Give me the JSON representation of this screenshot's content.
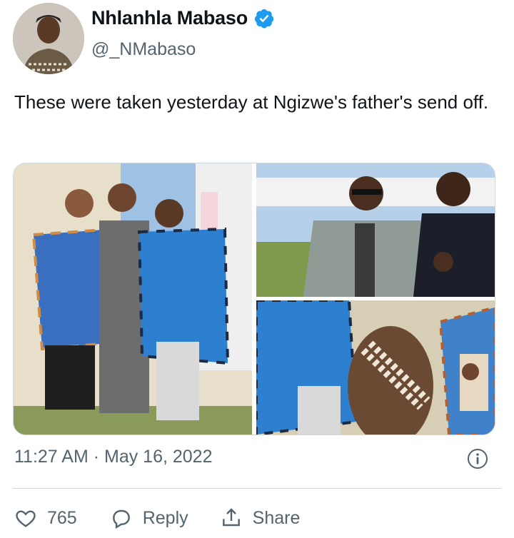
{
  "author": {
    "display_name": "Nhlanhla Mabaso",
    "handle": "@_NMabaso",
    "verified": true,
    "avatar_icon": "profile-avatar"
  },
  "tweet": {
    "text": "These were taken yesterday at Ngizwe's father's send off.",
    "timestamp": "11:27 AM · May 16, 2022"
  },
  "media": {
    "photos": [
      "photo-women-blankets",
      "photo-men-outdoors",
      "photo-shield-blankets"
    ]
  },
  "actions": {
    "like_count": "765",
    "reply_label": "Reply",
    "share_label": "Share"
  },
  "icons": {
    "verified": "verified-badge-icon",
    "info": "info-icon",
    "like": "heart-icon",
    "reply": "reply-bubble-icon",
    "share": "share-icon"
  },
  "colors": {
    "verified_blue": "#1d9bf0",
    "secondary_text": "#536471",
    "divider": "#cfd9de"
  }
}
